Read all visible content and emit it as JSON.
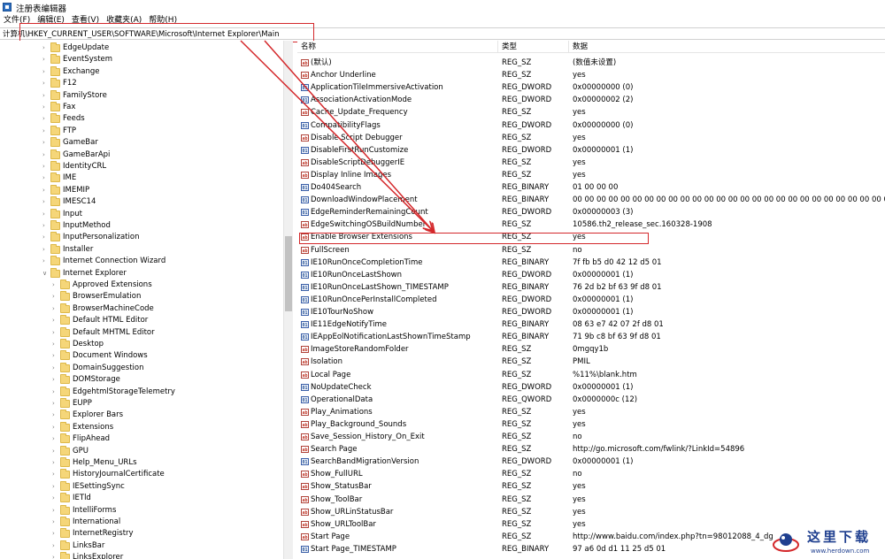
{
  "window": {
    "title": "注册表编辑器"
  },
  "menu": [
    {
      "label": "文件(F)"
    },
    {
      "label": "编辑(E)"
    },
    {
      "label": "查看(V)"
    },
    {
      "label": "收藏夹(A)"
    },
    {
      "label": "帮助(H)"
    }
  ],
  "address": {
    "path": "计算机\\HKEY_CURRENT_USER\\SOFTWARE\\Microsoft\\Internet Explorer\\Main"
  },
  "tree": [
    {
      "label": "EdgeUpdate",
      "level": 1
    },
    {
      "label": "EventSystem",
      "level": 1
    },
    {
      "label": "Exchange",
      "level": 1
    },
    {
      "label": "F12",
      "level": 1
    },
    {
      "label": "FamilyStore",
      "level": 1
    },
    {
      "label": "Fax",
      "level": 1
    },
    {
      "label": "Feeds",
      "level": 1
    },
    {
      "label": "FTP",
      "level": 1
    },
    {
      "label": "GameBar",
      "level": 1
    },
    {
      "label": "GameBarApi",
      "level": 1
    },
    {
      "label": "IdentityCRL",
      "level": 1
    },
    {
      "label": "IME",
      "level": 1
    },
    {
      "label": "IMEMIP",
      "level": 1
    },
    {
      "label": "IMESC14",
      "level": 1
    },
    {
      "label": "Input",
      "level": 1
    },
    {
      "label": "InputMethod",
      "level": 1
    },
    {
      "label": "InputPersonalization",
      "level": 1
    },
    {
      "label": "Installer",
      "level": 1
    },
    {
      "label": "Internet Connection Wizard",
      "level": 1
    },
    {
      "label": "Internet Explorer",
      "level": 1,
      "expanded": true
    },
    {
      "label": "Approved Extensions",
      "level": 2
    },
    {
      "label": "BrowserEmulation",
      "level": 2
    },
    {
      "label": "BrowserMachineCode",
      "level": 2
    },
    {
      "label": "Default HTML Editor",
      "level": 2
    },
    {
      "label": "Default MHTML Editor",
      "level": 2
    },
    {
      "label": "Desktop",
      "level": 2
    },
    {
      "label": "Document Windows",
      "level": 2
    },
    {
      "label": "DomainSuggestion",
      "level": 2
    },
    {
      "label": "DOMStorage",
      "level": 2
    },
    {
      "label": "EdgehtmlStorageTelemetry",
      "level": 2
    },
    {
      "label": "EUPP",
      "level": 2
    },
    {
      "label": "Explorer Bars",
      "level": 2
    },
    {
      "label": "Extensions",
      "level": 2
    },
    {
      "label": "FlipAhead",
      "level": 2
    },
    {
      "label": "GPU",
      "level": 2
    },
    {
      "label": "Help_Menu_URLs",
      "level": 2
    },
    {
      "label": "HistoryJournalCertificate",
      "level": 2
    },
    {
      "label": "IESettingSync",
      "level": 2
    },
    {
      "label": "IETld",
      "level": 2
    },
    {
      "label": "IntelliForms",
      "level": 2
    },
    {
      "label": "International",
      "level": 2
    },
    {
      "label": "InternetRegistry",
      "level": 2
    },
    {
      "label": "LinksBar",
      "level": 2
    },
    {
      "label": "LinksExplorer",
      "level": 2
    }
  ],
  "list": {
    "headers": {
      "name": "名称",
      "type": "类型",
      "data": "数据"
    },
    "rows": [
      {
        "name": "(默认)",
        "type": "REG_SZ",
        "data": "(数值未设置)",
        "kind": "sz"
      },
      {
        "name": "Anchor Underline",
        "type": "REG_SZ",
        "data": "yes",
        "kind": "sz"
      },
      {
        "name": "ApplicationTileImmersiveActivation",
        "type": "REG_DWORD",
        "data": "0x00000000 (0)",
        "kind": "bin"
      },
      {
        "name": "AssociationActivationMode",
        "type": "REG_DWORD",
        "data": "0x00000002 (2)",
        "kind": "bin"
      },
      {
        "name": "Cache_Update_Frequency",
        "type": "REG_SZ",
        "data": "yes",
        "kind": "sz"
      },
      {
        "name": "CompatibilityFlags",
        "type": "REG_DWORD",
        "data": "0x00000000 (0)",
        "kind": "bin"
      },
      {
        "name": "Disable Script Debugger",
        "type": "REG_SZ",
        "data": "yes",
        "kind": "sz"
      },
      {
        "name": "DisableFirstRunCustomize",
        "type": "REG_DWORD",
        "data": "0x00000001 (1)",
        "kind": "bin"
      },
      {
        "name": "DisableScriptDebuggerIE",
        "type": "REG_SZ",
        "data": "yes",
        "kind": "sz"
      },
      {
        "name": "Display Inline Images",
        "type": "REG_SZ",
        "data": "yes",
        "kind": "sz"
      },
      {
        "name": "Do404Search",
        "type": "REG_BINARY",
        "data": "01 00 00 00",
        "kind": "bin"
      },
      {
        "name": "DownloadWindowPlacement",
        "type": "REG_BINARY",
        "data": "00 00 00 00 00 00 00 00 00 00 00 00 00 00 00 00 00 00 00 00 00 00 00 00 00 00 00 00 00 00 00 00 00",
        "kind": "bin"
      },
      {
        "name": "EdgeReminderRemainingCount",
        "type": "REG_DWORD",
        "data": "0x00000003 (3)",
        "kind": "bin"
      },
      {
        "name": "EdgeSwitchingOSBuildNumber",
        "type": "REG_SZ",
        "data": "10586.th2_release_sec.160328-1908",
        "kind": "sz"
      },
      {
        "name": "Enable Browser Extensions",
        "type": "REG_SZ",
        "data": "yes",
        "kind": "sz"
      },
      {
        "name": "FullScreen",
        "type": "REG_SZ",
        "data": "no",
        "kind": "sz"
      },
      {
        "name": "IE10RunOnceCompletionTime",
        "type": "REG_BINARY",
        "data": "7f fb b5 d0 42 12 d5 01",
        "kind": "bin"
      },
      {
        "name": "IE10RunOnceLastShown",
        "type": "REG_DWORD",
        "data": "0x00000001 (1)",
        "kind": "bin"
      },
      {
        "name": "IE10RunOnceLastShown_TIMESTAMP",
        "type": "REG_BINARY",
        "data": "76 2d b2 bf 63 9f d8 01",
        "kind": "bin"
      },
      {
        "name": "IE10RunOncePerInstallCompleted",
        "type": "REG_DWORD",
        "data": "0x00000001 (1)",
        "kind": "bin"
      },
      {
        "name": "IE10TourNoShow",
        "type": "REG_DWORD",
        "data": "0x00000001 (1)",
        "kind": "bin"
      },
      {
        "name": "IE11EdgeNotifyTime",
        "type": "REG_BINARY",
        "data": "08 63 e7 42 07 2f d8 01",
        "kind": "bin"
      },
      {
        "name": "IEAppEolNotificationLastShownTimeStamp",
        "type": "REG_BINARY",
        "data": "71 9b c8 bf 63 9f d8 01",
        "kind": "bin"
      },
      {
        "name": "ImageStoreRandomFolder",
        "type": "REG_SZ",
        "data": "0mgqy1b",
        "kind": "sz"
      },
      {
        "name": "Isolation",
        "type": "REG_SZ",
        "data": "PMIL",
        "kind": "sz"
      },
      {
        "name": "Local Page",
        "type": "REG_SZ",
        "data": "%11%\\blank.htm",
        "kind": "sz"
      },
      {
        "name": "NoUpdateCheck",
        "type": "REG_DWORD",
        "data": "0x00000001 (1)",
        "kind": "bin"
      },
      {
        "name": "OperationalData",
        "type": "REG_QWORD",
        "data": "0x0000000c (12)",
        "kind": "bin"
      },
      {
        "name": "Play_Animations",
        "type": "REG_SZ",
        "data": "yes",
        "kind": "sz"
      },
      {
        "name": "Play_Background_Sounds",
        "type": "REG_SZ",
        "data": "yes",
        "kind": "sz"
      },
      {
        "name": "Save_Session_History_On_Exit",
        "type": "REG_SZ",
        "data": "no",
        "kind": "sz"
      },
      {
        "name": "Search Page",
        "type": "REG_SZ",
        "data": "http://go.microsoft.com/fwlink/?LinkId=54896",
        "kind": "sz"
      },
      {
        "name": "SearchBandMigrationVersion",
        "type": "REG_DWORD",
        "data": "0x00000001 (1)",
        "kind": "bin"
      },
      {
        "name": "Show_FullURL",
        "type": "REG_SZ",
        "data": "no",
        "kind": "sz"
      },
      {
        "name": "Show_StatusBar",
        "type": "REG_SZ",
        "data": "yes",
        "kind": "sz"
      },
      {
        "name": "Show_ToolBar",
        "type": "REG_SZ",
        "data": "yes",
        "kind": "sz"
      },
      {
        "name": "Show_URLinStatusBar",
        "type": "REG_SZ",
        "data": "yes",
        "kind": "sz"
      },
      {
        "name": "Show_URLToolBar",
        "type": "REG_SZ",
        "data": "yes",
        "kind": "sz"
      },
      {
        "name": "Start Page",
        "type": "REG_SZ",
        "data": "http://www.baidu.com/index.php?tn=98012088_4_dg",
        "kind": "sz"
      },
      {
        "name": "Start Page_TIMESTAMP",
        "type": "REG_BINARY",
        "data": "97 a6 0d d1 11 25 d5 01",
        "kind": "bin"
      }
    ]
  },
  "watermark": {
    "text": "这里下载",
    "url": "www.herdown.com"
  },
  "colors": {
    "highlight": "#d4282b",
    "folder": "#f5d679",
    "watermark": "#1f3f8f"
  }
}
